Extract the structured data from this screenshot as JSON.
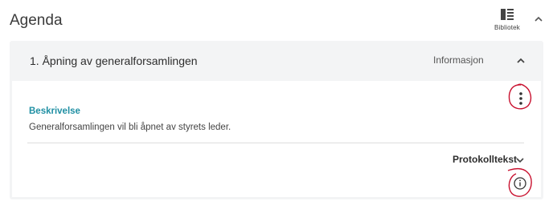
{
  "header": {
    "title": "Agenda",
    "library_label": "Bibliotek",
    "library_icon": "library-icon",
    "collapse_icon": "chevron-up-icon"
  },
  "agenda_item": {
    "title": "1. Åpning av generalforsamlingen",
    "type_label": "Informasjon",
    "collapse_icon": "chevron-up-icon",
    "menu_icon": "more-vertical-icon",
    "description_heading": "Beskrivelse",
    "description_text": "Generalforsamlingen vil bli åpnet av styrets leder.",
    "protocol_label": "Protokolltekst",
    "protocol_icon": "chevron-down-icon",
    "info_icon": "info-icon"
  },
  "colors": {
    "accent": "#1f8fa3",
    "card_background": "#f3f4f5",
    "annotation": "#c8102e"
  }
}
